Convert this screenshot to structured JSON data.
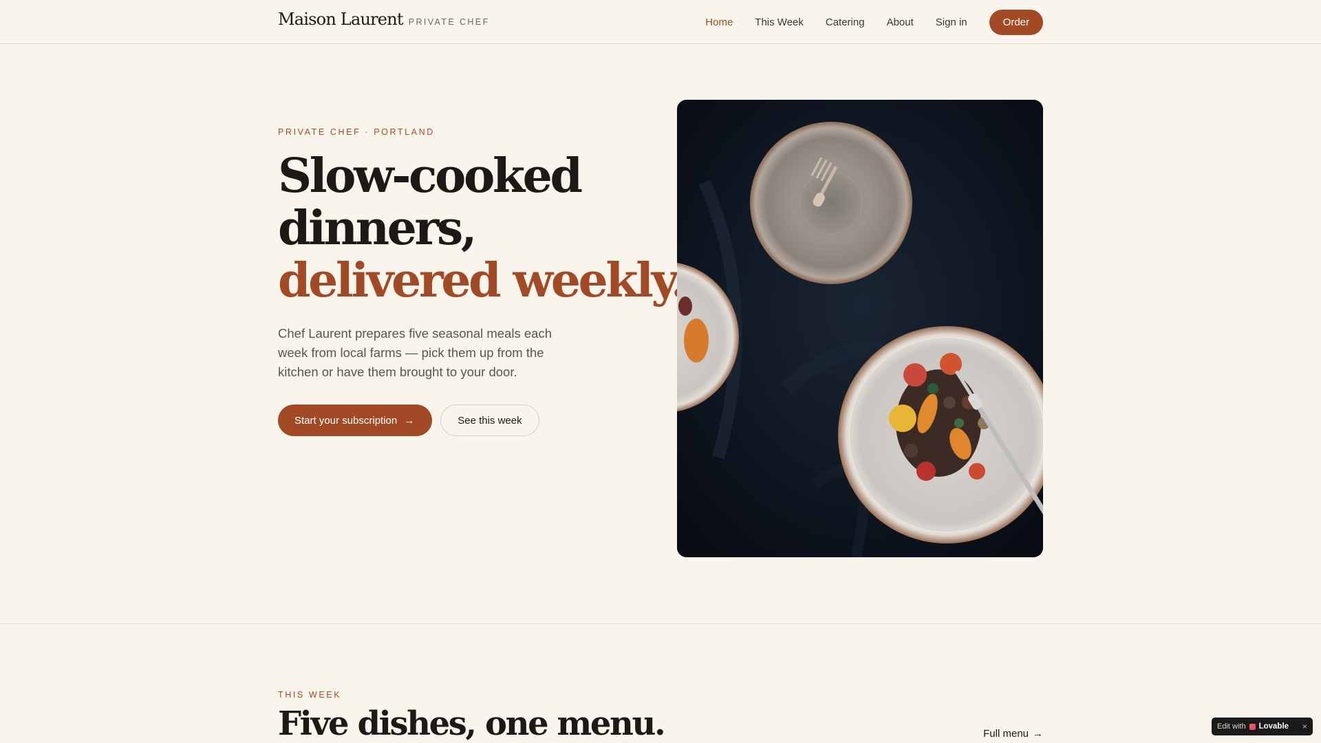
{
  "nav": {
    "brand_name": "Maison Laurent",
    "brand_sub": "PRIVATE CHEF",
    "links": [
      {
        "label": "Home",
        "active": true
      },
      {
        "label": "This Week",
        "active": false
      },
      {
        "label": "Catering",
        "active": false
      },
      {
        "label": "About",
        "active": false
      },
      {
        "label": "Sign in",
        "active": false
      }
    ],
    "order_label": "Order"
  },
  "hero": {
    "eyebrow": "PRIVATE CHEF · PORTLAND",
    "headline_line1": "Slow-cooked",
    "headline_line2": "dinners,",
    "headline_accent": "delivered weekly.",
    "lede": "Chef Laurent prepares five seasonal meals each week from local farms — pick them up from the kitchen or have them brought to your door.",
    "primary_cta": "Start your subscription",
    "secondary_cta": "See this week",
    "image_icon": "plated-dinner-photo"
  },
  "week": {
    "eyebrow": "THIS WEEK",
    "title": "Five dishes, one menu.",
    "full_menu_label": "Full menu"
  },
  "badge": {
    "prefix": "Edit with",
    "brand": "Lovable",
    "close": "×"
  },
  "colors": {
    "background": "#faf5ec",
    "accent": "#a24a26",
    "text": "#1c1a17",
    "muted": "#5a554e"
  }
}
